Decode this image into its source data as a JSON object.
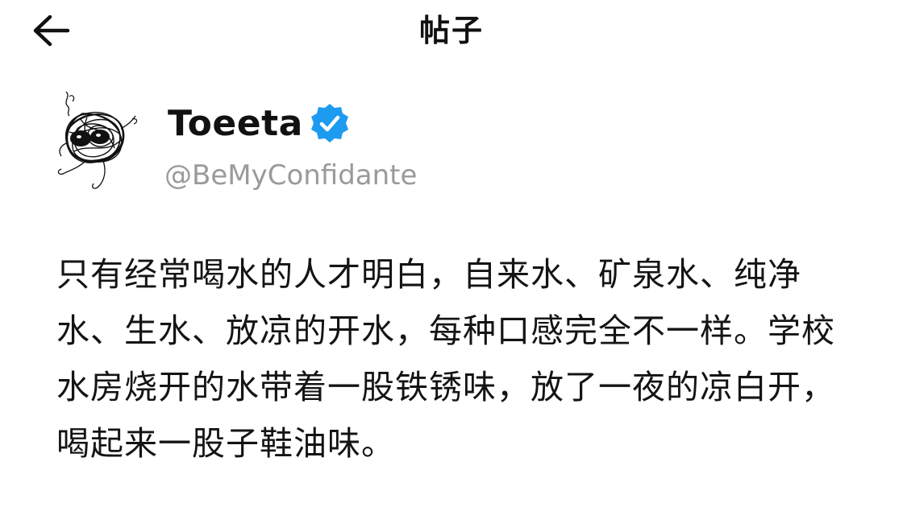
{
  "header": {
    "title": "帖子",
    "back_icon": "arrow-left-icon"
  },
  "author": {
    "avatar_icon": "scribble-creature-avatar",
    "display_name": "Toeeta",
    "handle": "@BeMyConfidante",
    "verified": true,
    "verified_icon": "verified-badge-icon"
  },
  "post": {
    "text": "只有经常喝水的人才明白，自来水、矿泉水、纯净水、生水、放凉的开水，每种口感完全不一样。学校水房烧开的水带着一股铁锈味，放了一夜的凉白开，喝起来一股子鞋油味。"
  },
  "colors": {
    "background": "#ffffff",
    "text": "#111111",
    "handle": "#9a9a9a",
    "verified_badge": "#1d9bf0"
  }
}
